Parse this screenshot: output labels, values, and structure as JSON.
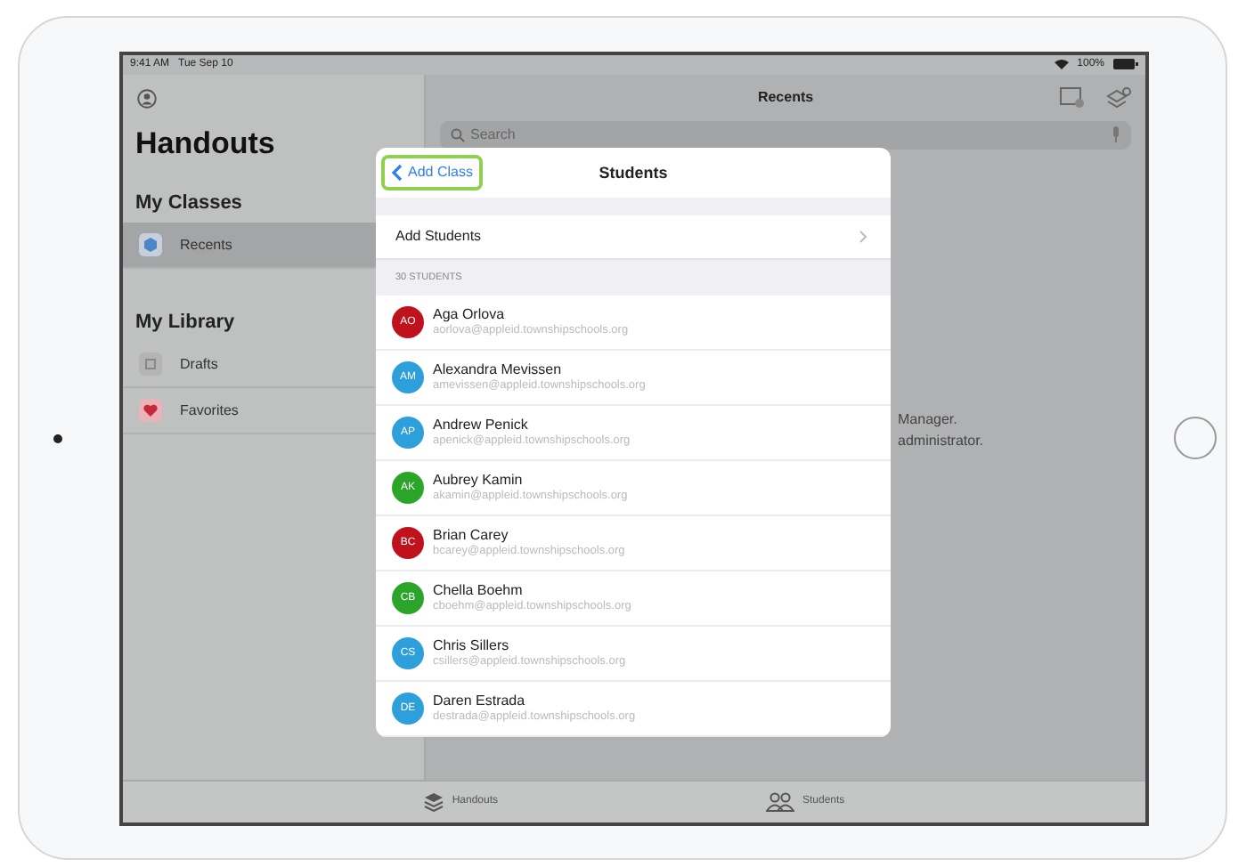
{
  "status_bar": {
    "time": "9:41 AM",
    "date": "Tue Sep 10",
    "battery": "100%"
  },
  "sidebar": {
    "title": "Handouts",
    "sections": [
      {
        "heading": "My Classes",
        "items": [
          {
            "label": "Recents",
            "kind": "class",
            "selected": true
          }
        ]
      },
      {
        "heading": "My Library",
        "items": [
          {
            "label": "Drafts",
            "kind": "drafts",
            "selected": false
          },
          {
            "label": "Favorites",
            "kind": "favorites",
            "selected": false
          }
        ]
      }
    ]
  },
  "detail": {
    "title": "Recents",
    "search": {
      "placeholder": "Search"
    },
    "message": [
      "Manager.",
      "administrator."
    ]
  },
  "modal": {
    "back_button": "Add Class",
    "title": "Students",
    "add_row": "Add Students",
    "section_header": "30 STUDENTS",
    "students": [
      {
        "initials": "AO",
        "name": "Aga Orlova",
        "email": "aorlova@appleid.townshipschools.org",
        "color": "#c0121d"
      },
      {
        "initials": "AM",
        "name": "Alexandra Mevissen",
        "email": "amevissen@appleid.townshipschools.org",
        "color": "#2d9fdb"
      },
      {
        "initials": "AP",
        "name": "Andrew Penick",
        "email": "apenick@appleid.townshipschools.org",
        "color": "#2d9fdb"
      },
      {
        "initials": "AK",
        "name": "Aubrey Kamin",
        "email": "akamin@appleid.townshipschools.org",
        "color": "#2aa52a"
      },
      {
        "initials": "BC",
        "name": "Brian Carey",
        "email": "bcarey@appleid.townshipschools.org",
        "color": "#c0121d"
      },
      {
        "initials": "CB",
        "name": "Chella Boehm",
        "email": "cboehm@appleid.townshipschools.org",
        "color": "#2aa52a"
      },
      {
        "initials": "CS",
        "name": "Chris Sillers",
        "email": "csillers@appleid.townshipschools.org",
        "color": "#2d9fdb"
      },
      {
        "initials": "DE",
        "name": "Daren Estrada",
        "email": "destrada@appleid.townshipschools.org",
        "color": "#2d9fdb"
      }
    ]
  },
  "tab_bar": [
    {
      "label": "Handouts",
      "kind": "handouts",
      "selected": false
    },
    {
      "label": "Students",
      "kind": "students",
      "selected": false
    }
  ]
}
